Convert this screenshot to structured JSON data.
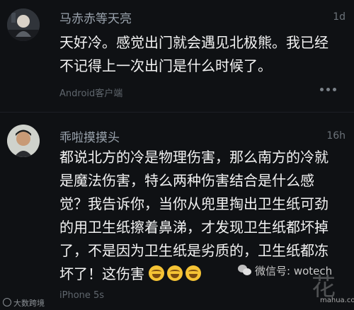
{
  "comments": [
    {
      "username": "马赤赤等天亮",
      "time": "1d",
      "lines": [
        "天好冷。感觉出门就会遇见北极熊。我已经",
        "不记得上一次出门是什么时候了。"
      ],
      "device": "Android客户端"
    },
    {
      "username": "乖啦摸摸头",
      "time": "16h",
      "lines": [
        "都说北方的冷是物理伤害，那么南方的冷就",
        "是魔法伤害，特么两种伤害结合是什么感",
        "觉？我告诉你，当你从兜里掏出卫生纸可劲",
        "的用卫生纸擦着鼻涕，才发现卫生纸都坏掉",
        "了，不是因为卫生纸是劣质的，卫生纸都冻",
        "坏了！这伤害"
      ],
      "emoji_count": 3,
      "device": "iPhone 5s"
    }
  ],
  "watermarks": {
    "bottom_left": "大数跨境",
    "wechat": "微信号: wotech",
    "site_logo": "花",
    "site_url": "mahua.com"
  },
  "colors": {
    "background": "#0f1114",
    "username": "#9aa3ad",
    "body_text": "#f3f3f3",
    "meta": "#5f666d"
  }
}
